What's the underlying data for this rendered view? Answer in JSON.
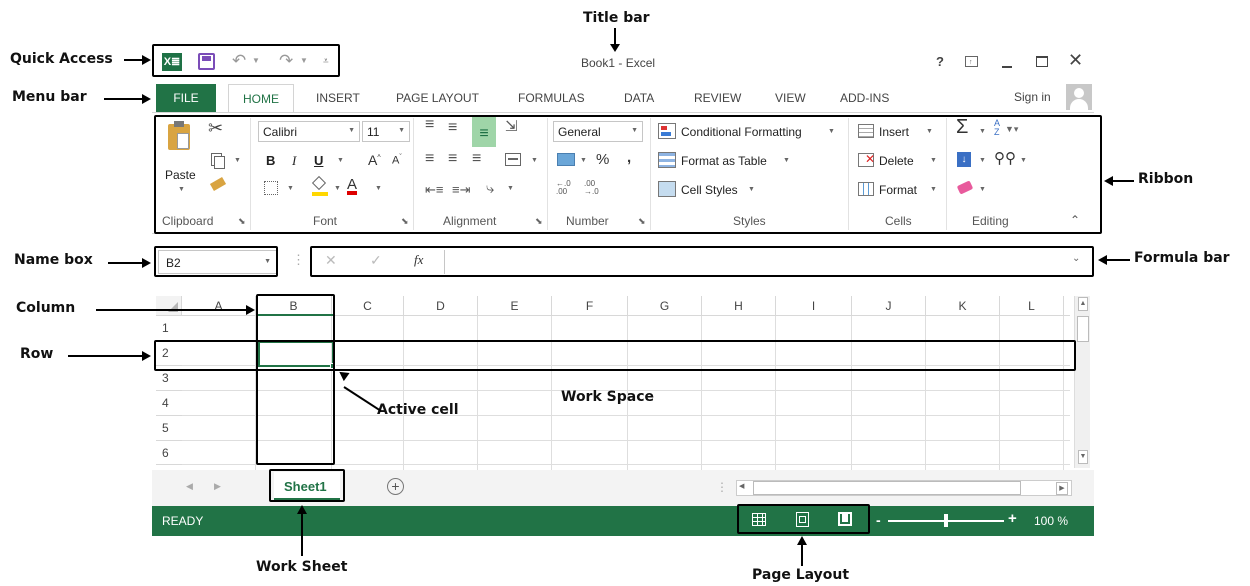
{
  "annotations": {
    "title_bar": "Title bar",
    "quick_access": "Quick Access",
    "menu_bar": "Menu bar",
    "ribbon": "Ribbon",
    "name_box": "Name box",
    "formula_bar": "Formula bar",
    "column": "Column",
    "row": "Row",
    "active_cell": "Active cell",
    "work_space": "Work Space",
    "work_sheet": "Work Sheet",
    "page_layout": "Page Layout"
  },
  "window": {
    "title": "Book1 - Excel",
    "help": "?",
    "sign_in": "Sign in"
  },
  "tabs": [
    "FILE",
    "HOME",
    "INSERT",
    "PAGE LAYOUT",
    "FORMULAS",
    "DATA",
    "REVIEW",
    "VIEW",
    "ADD-INS"
  ],
  "ribbon": {
    "clipboard": {
      "paste": "Paste",
      "label": "Clipboard"
    },
    "font": {
      "name": "Calibri",
      "size": "11",
      "bold": "B",
      "italic": "I",
      "underline": "U",
      "label": "Font"
    },
    "alignment": {
      "label": "Alignment"
    },
    "number": {
      "format": "General",
      "percent": "%",
      "comma": ",",
      "label": "Number"
    },
    "styles": {
      "conditional": "Conditional Formatting",
      "table": "Format as Table",
      "cell_styles": "Cell Styles",
      "label": "Styles"
    },
    "cells": {
      "insert": "Insert",
      "delete": "Delete",
      "format": "Format",
      "label": "Cells"
    },
    "editing": {
      "label": "Editing"
    }
  },
  "formula_bar": {
    "name_box": "B2",
    "fx": "fx",
    "value": ""
  },
  "grid": {
    "columns": [
      "A",
      "B",
      "C",
      "D",
      "E",
      "F",
      "G",
      "H",
      "I",
      "J",
      "K",
      "L"
    ],
    "rows": [
      "1",
      "2",
      "3",
      "4",
      "5",
      "6"
    ],
    "active_cell": "B2"
  },
  "sheets": {
    "tabs": [
      "Sheet1"
    ]
  },
  "status": {
    "text": "READY",
    "zoom": "100 %",
    "zoom_level": 100
  },
  "colors": {
    "excel_green": "#217346",
    "accent_green": "#1e7145"
  }
}
